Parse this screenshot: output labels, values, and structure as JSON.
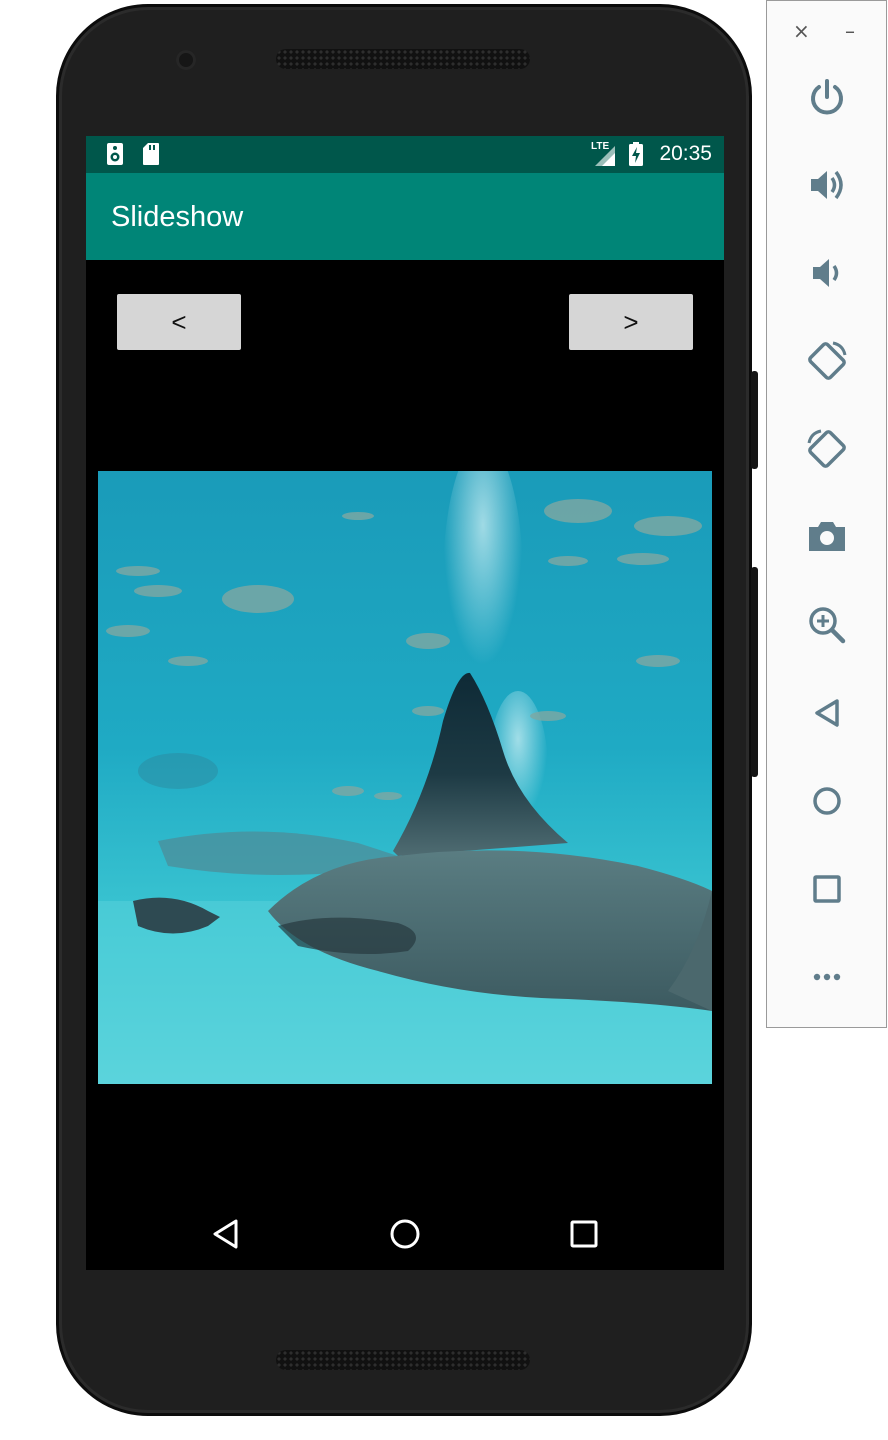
{
  "device": {
    "status_bar": {
      "time": "20:35",
      "network": "LTE",
      "notification_icons": [
        "speaker-icon",
        "sd-card-icon"
      ],
      "battery_icon": "battery-charging-icon"
    },
    "app_bar": {
      "title": "Slideshow"
    },
    "buttons": {
      "prev_label": "<",
      "next_label": ">"
    },
    "slide": {
      "description_icon": "manta-ray-aquarium-photo"
    },
    "nav_bar": {
      "keys": [
        "back-icon",
        "home-icon",
        "recents-icon"
      ]
    }
  },
  "colors": {
    "status_bar": "#00574b",
    "app_bar": "#008577",
    "button": "#d6d6d6",
    "screen_bg": "#000000"
  },
  "emulator_panel": {
    "window_controls": [
      "close-icon",
      "minimize-icon"
    ],
    "tools": [
      "power-icon",
      "volume-up-icon",
      "volume-down-icon",
      "rotate-left-icon",
      "rotate-right-icon",
      "camera-icon",
      "zoom-icon",
      "back-icon",
      "home-icon",
      "overview-icon",
      "more-icon"
    ],
    "close_glyph": "×",
    "minimize_glyph": "–"
  }
}
